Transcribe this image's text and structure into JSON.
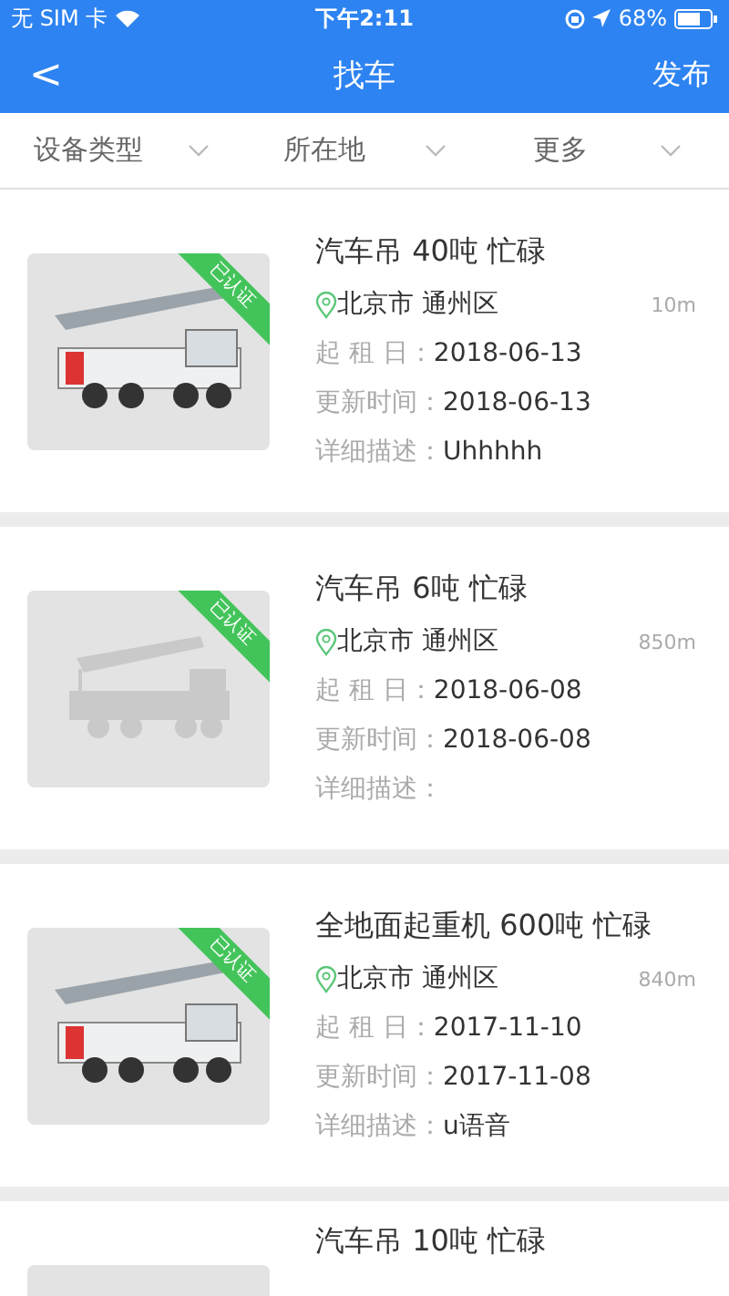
{
  "status_bar": {
    "carrier": "无 SIM 卡",
    "time": "下午2:11",
    "battery": "68%"
  },
  "nav": {
    "back": "<",
    "title": "找车",
    "action": "发布"
  },
  "filters": [
    {
      "label": "设备类型"
    },
    {
      "label": "所在地"
    },
    {
      "label": "更多"
    }
  ],
  "listings": [
    {
      "title": "汽车吊 40吨 忙碌",
      "kind": "photo",
      "badge": "已认证",
      "location": "北京市 通州区",
      "distance": "10m",
      "rent_label": "起 租 日：",
      "rent_date": "2018-06-13",
      "update_label": "更新时间：",
      "update_date": "2018-06-13",
      "desc_label": "详细描述：",
      "desc": "Uhhhhh"
    },
    {
      "title": "汽车吊 6吨 忙碌",
      "kind": "placeholder",
      "badge": "已认证",
      "location": "北京市 通州区",
      "distance": "850m",
      "rent_label": "起 租 日：",
      "rent_date": "2018-06-08",
      "update_label": "更新时间：",
      "update_date": "2018-06-08",
      "desc_label": "详细描述："
    },
    {
      "title": "全地面起重机 600吨 忙碌",
      "kind": "photo",
      "badge": "已认证",
      "location": "北京市 通州区",
      "distance": "840m",
      "rent_label": "起 租 日：",
      "rent_date": "2017-11-10",
      "update_label": "更新时间：",
      "update_date": "2017-11-08",
      "desc_label": "详细描述：",
      "desc": "u语音"
    },
    {
      "title": "汽车吊 10吨 忙碌"
    }
  ]
}
